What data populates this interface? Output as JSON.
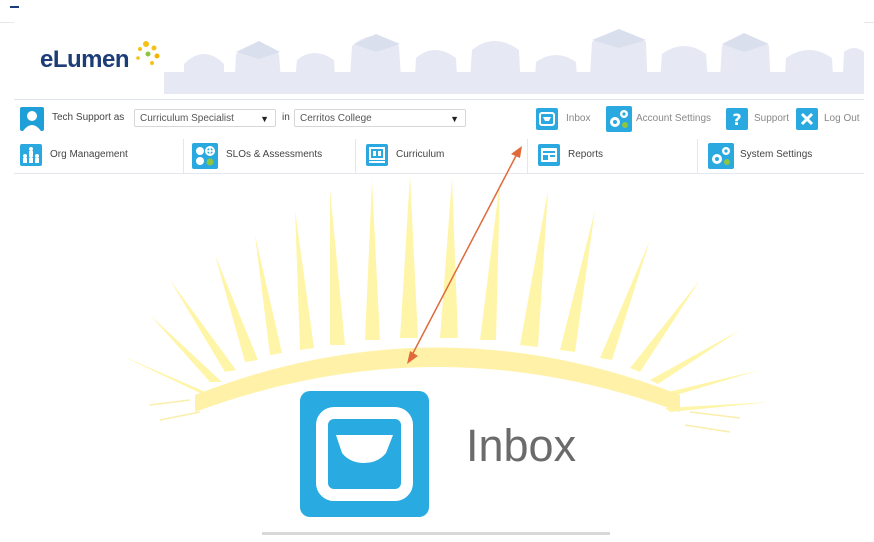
{
  "header": {
    "logo_text": "eLumen"
  },
  "userbar": {
    "prefix": "Tech Support as",
    "role_select": "Curriculum Specialist",
    "in_label": "in",
    "college_select": "Cerritos College",
    "links": [
      {
        "label": "Inbox",
        "icon": "inbox-icon"
      },
      {
        "label": "Account Settings",
        "icon": "gears-icon"
      },
      {
        "label": "Support",
        "icon": "question-icon"
      },
      {
        "label": "Log Out",
        "icon": "close-icon"
      }
    ]
  },
  "nav": {
    "items": [
      {
        "label": "Org Management",
        "icon": "org-icon"
      },
      {
        "label": "SLOs & Assessments",
        "icon": "slo-icon"
      },
      {
        "label": "Curriculum",
        "icon": "curriculum-icon"
      },
      {
        "label": "Reports",
        "icon": "reports-icon"
      },
      {
        "label": "System Settings",
        "icon": "settings-icon"
      }
    ]
  },
  "feature": {
    "label": "Inbox",
    "icon": "inbox-icon"
  },
  "colors": {
    "brand_blue": "#1d3d79",
    "icon_blue": "#29abe2",
    "ray_yellow": "#fff6a3",
    "arrow": "#e06a3a"
  }
}
